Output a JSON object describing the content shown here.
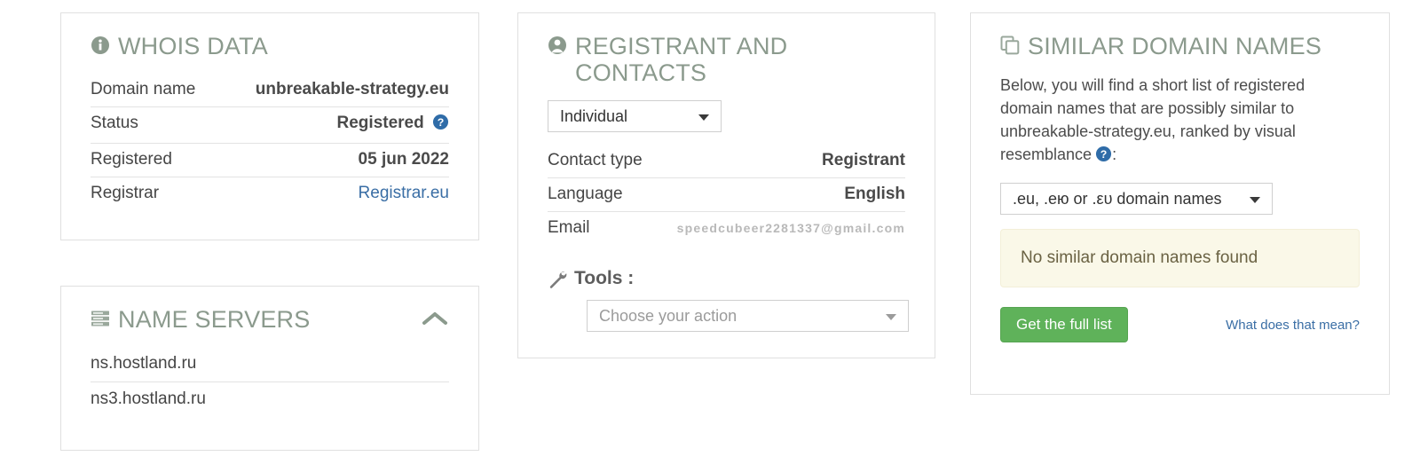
{
  "colors": {
    "heading": "#8b9a8d",
    "link": "#3a6ea5",
    "button_green": "#5fb25a",
    "alert_bg": "#faf8e8",
    "alert_text": "#6a6243",
    "help_blue": "#2f6ca8"
  },
  "whois_panel": {
    "icon": "info-icon",
    "title": "WHOIS DATA",
    "rows": [
      {
        "key": "Domain name",
        "value": "unbreakable-strategy.eu",
        "style": "bold"
      },
      {
        "key": "Status",
        "value": "Registered",
        "style": "bold",
        "help": true
      },
      {
        "key": "Registered",
        "value": "05 jun 2022",
        "style": "bold"
      },
      {
        "key": "Registrar",
        "value": "Registrar.eu",
        "style": "link"
      }
    ]
  },
  "nameservers_panel": {
    "icon": "server-icon",
    "title": "NAME SERVERS",
    "collapse_icon": "chevron-up-icon",
    "servers": [
      {
        "name": "ns.hostland.ru"
      },
      {
        "name": "ns3.hostland.ru"
      }
    ]
  },
  "registrant_panel": {
    "icon": "user-icon",
    "title": "REGISTRANT AND CONTACTS",
    "contact_select": {
      "value": "Individual",
      "caret": "chevron-down-icon"
    },
    "rows": [
      {
        "key": "Contact type",
        "value": "Registrant",
        "style": "bold"
      },
      {
        "key": "Language",
        "value": "English",
        "style": "bold"
      },
      {
        "key": "Email",
        "value": "speedcubeer2281337@gmail.com",
        "style": "email"
      }
    ],
    "tools": {
      "icon": "wrench-icon",
      "label": "Tools :",
      "select_placeholder": "Choose your action",
      "caret": "chevron-down-icon"
    }
  },
  "similar_panel": {
    "icon": "copy-icon",
    "title": "SIMILAR DOMAIN NAMES",
    "description": "Below, you will find a short list of registered domain names that are possibly similar to unbreakable-strategy.eu, ranked by visual resemblance",
    "description_suffix": ":",
    "help": true,
    "tld_select": {
      "value": ".eu, .ею or .ευ domain names",
      "caret": "chevron-down-icon"
    },
    "alert_text": "No similar domain names found",
    "full_list_button": "Get the full list",
    "explain_link": "What does that mean?"
  }
}
